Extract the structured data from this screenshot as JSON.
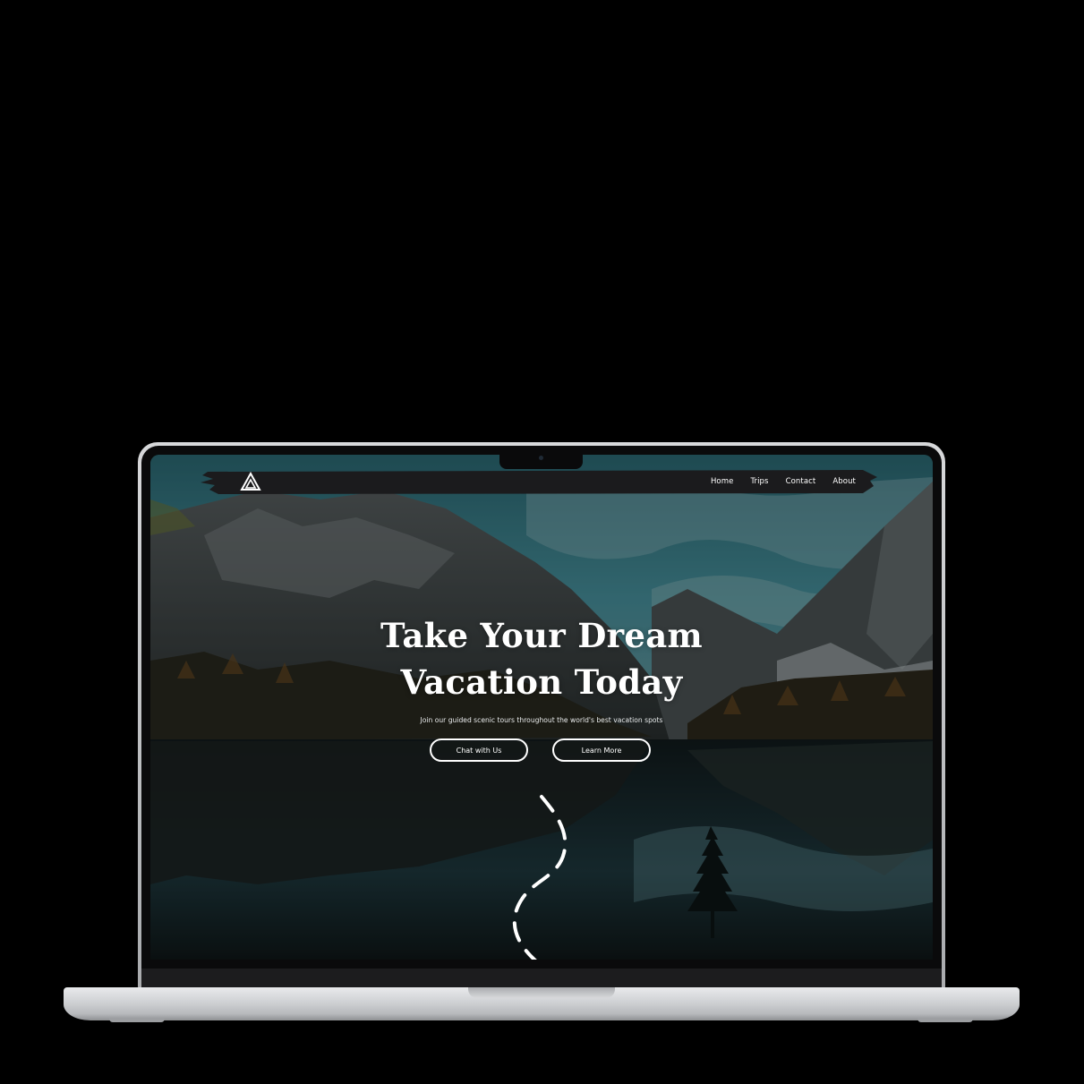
{
  "nav": {
    "logo_icon": "mountain-triangle-logo-icon",
    "items": [
      {
        "label": "Home"
      },
      {
        "label": "Trips"
      },
      {
        "label": "Contact"
      },
      {
        "label": "About"
      }
    ]
  },
  "hero": {
    "title_line1": "Take Your Dream",
    "title_line2": "Vacation Today",
    "subtitle": "Join our guided scenic tours throughout the world's best vacation spots",
    "buttons": {
      "chat_label": "Chat with Us",
      "learn_label": "Learn More"
    },
    "decoration_icon": "dashed-trail-path-icon"
  },
  "colors": {
    "background": "#000000",
    "nav_bar": "#1b1b1d",
    "text": "#ffffff",
    "sky": "#3f8d9a",
    "lake": "#0f1a1c"
  }
}
